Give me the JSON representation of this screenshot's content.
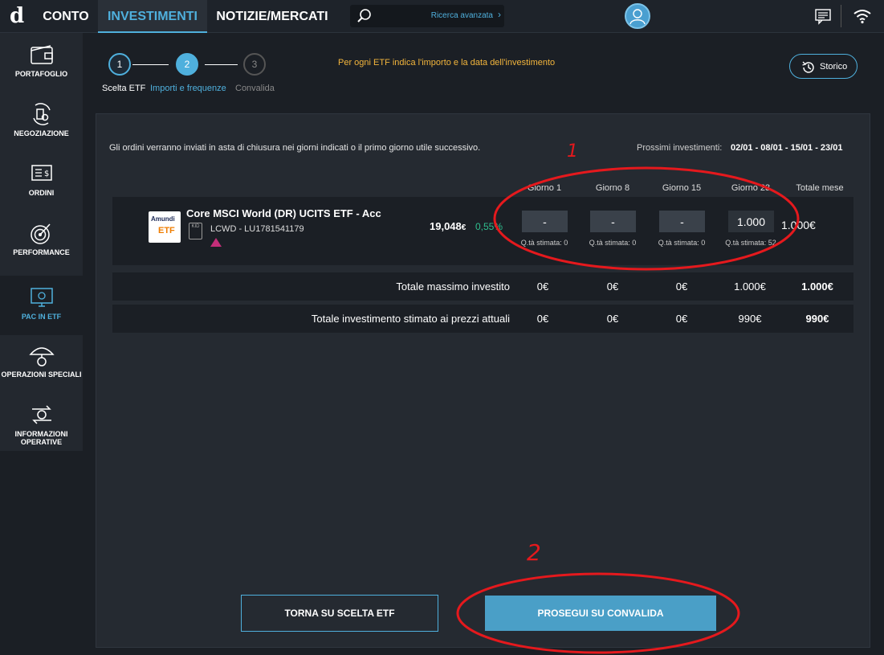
{
  "topbar": {
    "logo": "d",
    "tabs": [
      "CONTO",
      "INVESTIMENTI",
      "NOTIZIE/MERCATI"
    ],
    "search_advanced": "Ricerca avanzata"
  },
  "sidebar": {
    "items": [
      {
        "label": "PORTAFOGLIO"
      },
      {
        "label": "NEGOZIAZIONE"
      },
      {
        "label": "ORDINI"
      },
      {
        "label": "PERFORMANCE"
      },
      {
        "label": "PAC IN ETF"
      },
      {
        "label": "OPERAZIONI SPECIALI"
      },
      {
        "label": "INFORMAZIONI OPERATIVE"
      }
    ]
  },
  "stepper": {
    "steps": [
      {
        "num": "1",
        "label": "Scelta ETF"
      },
      {
        "num": "2",
        "label": "Importi e frequenze"
      },
      {
        "num": "3",
        "label": "Convalida"
      }
    ],
    "hint": "Per ogni ETF indica l'importo e la data dell'investimento",
    "history_button": "Storico"
  },
  "panel": {
    "info": "Gli ordini verranno inviati in asta di chiusura nei giorni indicati o il primo giorno utile successivo.",
    "next_label": "Prossimi investimenti:",
    "next_dates": "02/01 - 08/01 - 15/01 - 23/01",
    "columns": [
      "Giorno 1",
      "Giorno 8",
      "Giorno 15",
      "Giorno 23",
      "Totale mese"
    ],
    "etf": {
      "brand_top": "Amundi",
      "brand_bottom": "ETF",
      "kid": "KID",
      "name": "Core MSCI World (DR) UCITS ETF - Acc",
      "code": "LCWD - LU1781541179",
      "price": "19,048",
      "currency": "€",
      "change": "0,55%",
      "inputs": [
        "-",
        "-",
        "-",
        "1.000"
      ],
      "qta": [
        "Q.tà stimata: 0",
        "Q.tà stimata: 0",
        "Q.tà stimata: 0",
        "Q.tà stimata: 52"
      ],
      "month_total": "1.000€"
    },
    "totals": [
      {
        "label": "Totale massimo investito",
        "values": [
          "0€",
          "0€",
          "0€",
          "1.000€",
          "1.000€"
        ]
      },
      {
        "label": "Totale investimento stimato ai prezzi attuali",
        "values": [
          "0€",
          "0€",
          "0€",
          "990€",
          "990€"
        ]
      }
    ],
    "back_button": "TORNA SU SCELTA ETF",
    "next_button": "PROSEGUI SU CONVALIDA"
  },
  "annotations": {
    "mark1": "1",
    "mark2": "2"
  },
  "colors": {
    "accent": "#4fb0dd",
    "hint": "#f3b53c",
    "positive": "#2fbf8f",
    "annotation": "#e5191d"
  }
}
